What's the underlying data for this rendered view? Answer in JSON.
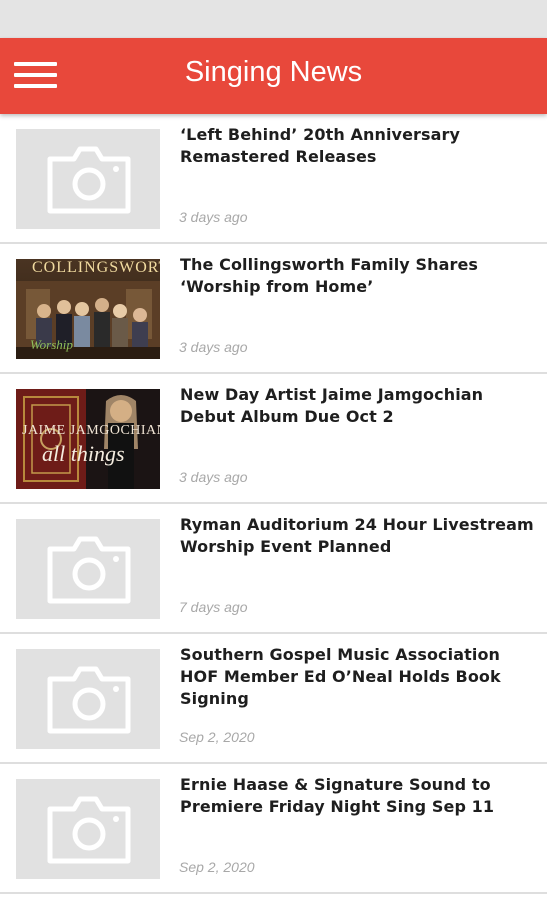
{
  "app": {
    "title": "Singing News"
  },
  "icons": {
    "menu": "hamburger-menu-icon",
    "placeholder": "camera-icon"
  },
  "colors": {
    "appbar": "#e8483b",
    "placeholder_bg": "#e1e1e1",
    "date_text": "#a8a8a8"
  },
  "articles": [
    {
      "title": "‘Left Behind’ 20th Anniversary Remastered Releases",
      "date": "3 days ago",
      "image": "placeholder"
    },
    {
      "title": "The Collingsworth Family Shares ‘Worship from Home’",
      "date": "3 days ago",
      "image": "photo",
      "image_text": [
        "COLLINGSWORTH",
        "Worship"
      ]
    },
    {
      "title": "New Day Artist Jaime Jamgochian Debut Album Due Oct 2",
      "date": "3 days ago",
      "image": "photo",
      "image_text": [
        "JAIME JAMGOCHIAN",
        "all things"
      ]
    },
    {
      "title": "Ryman Auditorium 24 Hour Livestream Worship Event Planned",
      "date": "7 days ago",
      "image": "placeholder"
    },
    {
      "title": "Southern Gospel Music Association HOF Member Ed O’Neal Holds Book Signing",
      "date": "Sep 2, 2020",
      "image": "placeholder"
    },
    {
      "title": "Ernie Haase & Signature Sound to Premiere Friday Night Sing Sep 11",
      "date": "Sep 2, 2020",
      "image": "placeholder"
    }
  ]
}
